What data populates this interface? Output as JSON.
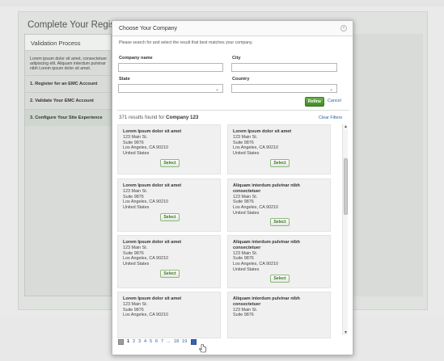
{
  "background": {
    "page_title": "Complete Your Registration",
    "panel_title": "Validation Process",
    "panel_text": "Lorem ipsum dolor sit amet, consectetuer adipiscing elit. Aliquam interdum pulvinar nibh Lorem ipsum dolor sit amet.",
    "steps": [
      {
        "label": "1. Register for an EMC Account",
        "active": false
      },
      {
        "label": "2. Validate Your EMC Account",
        "active": false
      },
      {
        "label": "3. Configure Your Site Experience",
        "active": true
      }
    ]
  },
  "modal": {
    "title": "Choose Your Company",
    "close_label": "×",
    "instructions": "Please search for and select the result that best matches your company.",
    "fields": {
      "company_name_label": "Company name",
      "company_name_value": "",
      "city_label": "City",
      "city_value": "",
      "state_label": "State",
      "state_value": "",
      "country_label": "Country",
      "country_value": ""
    },
    "refine_label": "Refine",
    "cancel_label": "Cancel",
    "results_count_prefix": "371 results found for ",
    "results_query": "Company 123",
    "clear_filters_label": "Clear Filters",
    "select_label": "Select",
    "results": [
      {
        "name": "Lorem Ipsum dolor sit amet",
        "lines": [
          "123 Main St.",
          "Suite 9876",
          "Los Angeles, CA 90210",
          "United States"
        ]
      },
      {
        "name": "Lorem Ipsum dolor sit amet",
        "lines": [
          "123 Main St.",
          "Suite 9876",
          "Los Angeles, CA 90210",
          "United States"
        ]
      },
      {
        "name": "Lorem Ipsum dolor sit amet",
        "lines": [
          "123 Main St.",
          "Suite 9876",
          "Los Angeles, CA 90210",
          "United States"
        ]
      },
      {
        "name": "Aliquam interdum pulvinar nibh consectetuer",
        "lines": [
          "123 Main St.",
          "Suite 9876",
          "Los Angeles, CA 90210",
          "United States"
        ]
      },
      {
        "name": "Lorem Ipsum dolor sit amet",
        "lines": [
          "123 Main St.",
          "Suite 9876",
          "Los Angeles, CA 90210",
          "United States"
        ]
      },
      {
        "name": "Aliquam interdum pulvinar nibh consectetuer",
        "lines": [
          "123 Main St.",
          "Suite 9876",
          "Los Angeles, CA 90210",
          "United States"
        ]
      },
      {
        "name": "Lorem Ipsum dolor sit amet",
        "lines": [
          "123 Main St.",
          "Suite 9876",
          "Los Angeles, CA 90210"
        ]
      },
      {
        "name": "Aliquam interdum pulvinar nibh consectetuer",
        "lines": [
          "123 Main St.",
          "Suite 9876"
        ]
      }
    ],
    "pagination": {
      "pages": [
        "1",
        "2",
        "3",
        "4",
        "5",
        "6",
        "7",
        "...",
        "18",
        "19"
      ],
      "current": "1"
    }
  },
  "colors": {
    "accent_green": "#3e8a25",
    "link_blue": "#2a5ea8",
    "card_background": "#eff0ef"
  },
  "icons": {
    "close": "close-icon",
    "dropdown": "chevron-down-icon",
    "prev": "prev-page-icon",
    "next": "next-page-icon",
    "cursor": "hand-pointer-icon"
  }
}
